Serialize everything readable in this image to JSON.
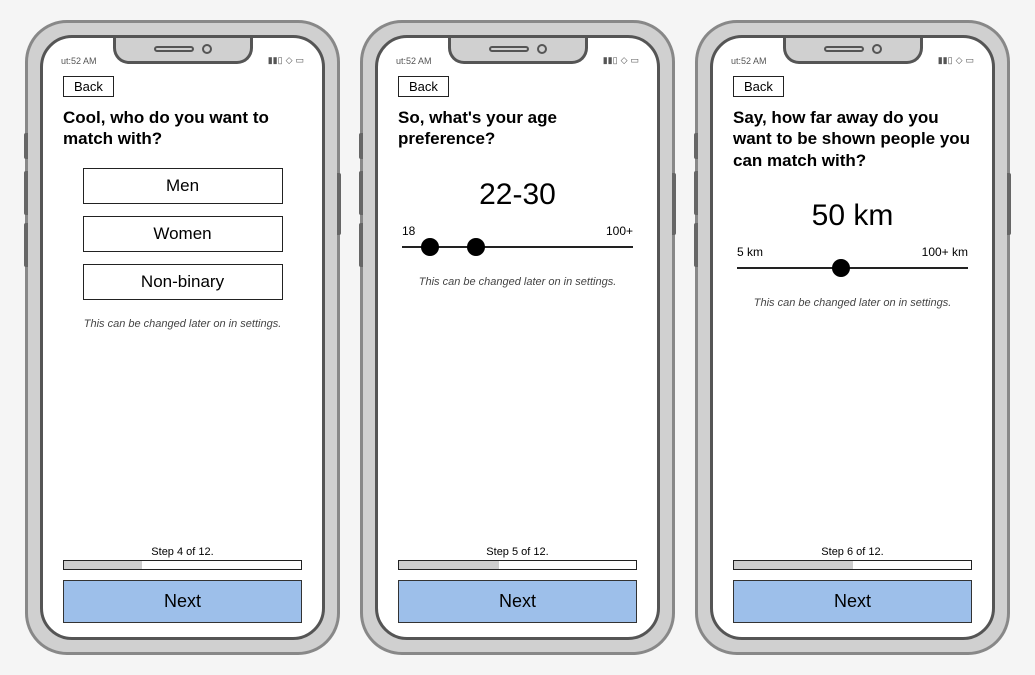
{
  "status_time": "ut:52 AM",
  "screens": [
    {
      "back_label": "Back",
      "question": "Cool, who do you want to match with?",
      "options": [
        "Men",
        "Women",
        "Non-binary"
      ],
      "hint": "This can be changed later on in settings.",
      "step_label": "Step 4 of 12.",
      "progress_pct": 33,
      "next_label": "Next"
    },
    {
      "back_label": "Back",
      "question": "So, what's your age preference?",
      "range_value": "22-30",
      "slider_min_label": "18",
      "slider_max_label": "100+",
      "knob1_pct": 12,
      "knob2_pct": 32,
      "hint": "This can be changed later on in settings.",
      "step_label": "Step 5 of 12.",
      "progress_pct": 42,
      "next_label": "Next"
    },
    {
      "back_label": "Back",
      "question": "Say, how far away do you want to be shown people you can match with?",
      "range_value": "50 km",
      "slider_min_label": "5 km",
      "slider_max_label": "100+ km",
      "knob1_pct": 45,
      "hint": "This can be changed later on in settings.",
      "step_label": "Step 6 of 12.",
      "progress_pct": 50,
      "next_label": "Next"
    }
  ]
}
